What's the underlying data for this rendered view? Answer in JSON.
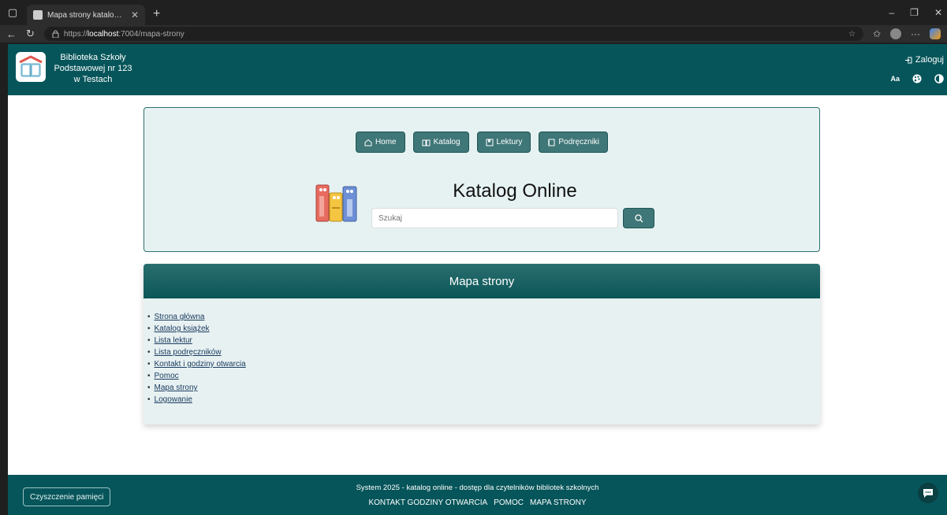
{
  "browser": {
    "tab_title": "Mapa strony katalogu biblioteki S",
    "url_prefix": "https://",
    "url_host": "localhost",
    "url_path": ":7004/mapa-strony"
  },
  "header": {
    "school_line1": "Biblioteka Szkoły",
    "school_line2": "Podstawowej nr 123",
    "school_line3": "w Testach",
    "login_label": "Zaloguj",
    "font_size_label": "Aa"
  },
  "nav": {
    "items": [
      {
        "label": "Home",
        "icon": "home-icon"
      },
      {
        "label": "Katalog",
        "icon": "book-open-icon"
      },
      {
        "label": "Lektury",
        "icon": "bookmark-icon"
      },
      {
        "label": "Podręczniki",
        "icon": "journal-icon"
      }
    ]
  },
  "hero": {
    "title": "Katalog Online",
    "search_placeholder": "Szukaj"
  },
  "sitemap": {
    "title": "Mapa strony",
    "links": [
      "Strona główna",
      "Katalog książek",
      "Lista lektur",
      "Lista podręczników",
      "Kontakt i godziny otwarcia",
      "Pomoc",
      "Mapa strony",
      "Logowanie"
    ]
  },
  "footer": {
    "clear_cache_label": "Czyszczenie pamięci",
    "tagline": "System 2025 - katalog online - dostęp dla czytelników bibliotek szkolnych",
    "links": [
      "KONTAKT GODZINY OTWARCIA",
      "POMOC",
      "MAPA STRONY"
    ]
  },
  "colors": {
    "brand": "#06555a",
    "button": "#3f7677",
    "hero_bg": "#e6f2f2"
  }
}
